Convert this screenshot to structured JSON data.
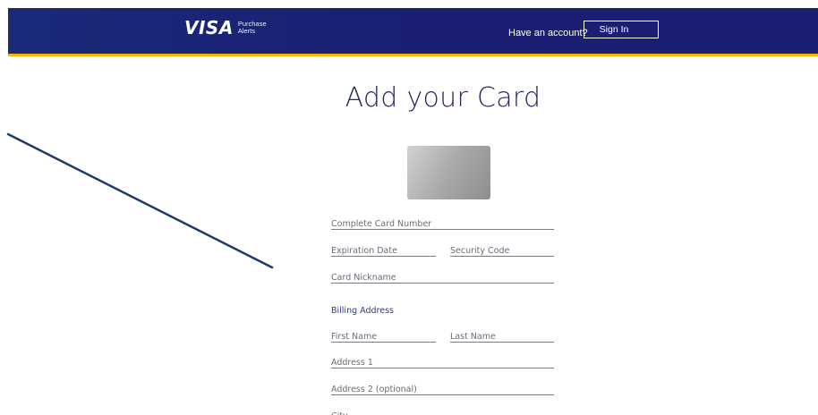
{
  "header": {
    "logo_mark": "VISA",
    "logo_sub_line1": "Purchase",
    "logo_sub_line2": "Alerts",
    "account_prompt": "Have an account?",
    "sign_in_label": "Sign In"
  },
  "colors": {
    "header_bg": "#1a1f71",
    "header_stripe": "#f7b600",
    "title": "#23285e",
    "section_label": "#2b3a8c",
    "annotation_line": "#1f3a68"
  },
  "main": {
    "title": "Add your Card",
    "card_image": "card-placeholder-image",
    "section_billing": "Billing Address"
  },
  "form": {
    "card_number_placeholder": "Complete Card Number",
    "expiration_placeholder": "Expiration Date",
    "security_code_placeholder": "Security Code",
    "nickname_placeholder": "Card Nickname",
    "first_name_placeholder": "First Name",
    "last_name_placeholder": "Last Name",
    "address1_placeholder": "Address 1",
    "address2_placeholder": "Address 2 (optional)",
    "city_placeholder": "City"
  }
}
